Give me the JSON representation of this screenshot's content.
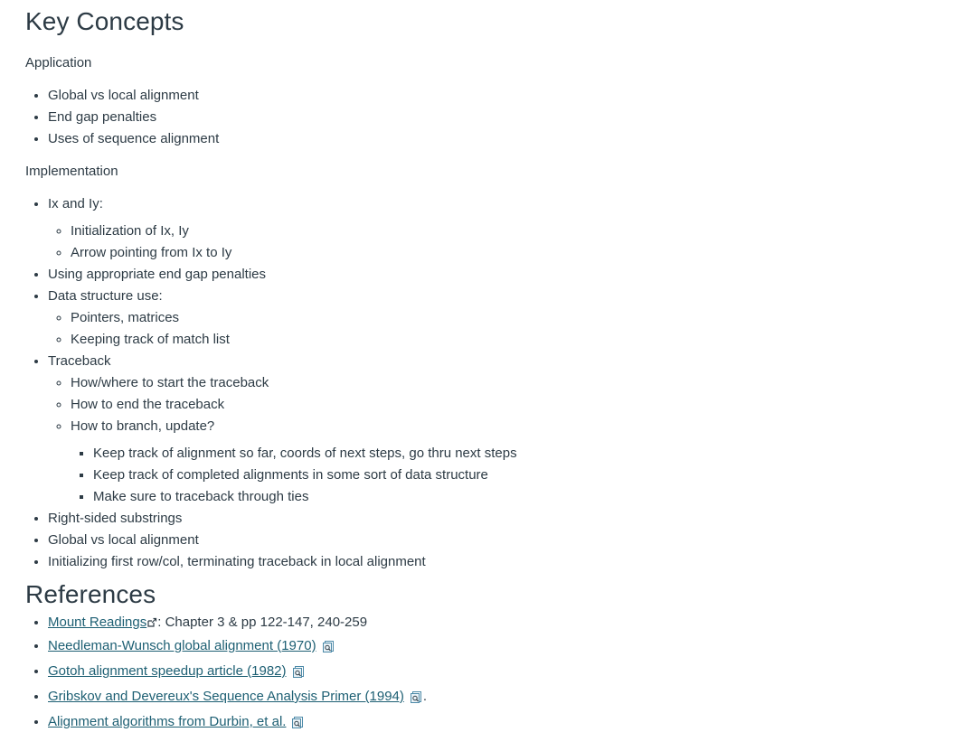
{
  "key_concepts": {
    "title": "Key Concepts",
    "application_label": "Application",
    "application_items": [
      "Global vs local alignment",
      "End gap penalties",
      "Uses of sequence alignment"
    ],
    "implementation_label": "Implementation",
    "ixiy": {
      "label": "Ix and Iy:",
      "children": [
        "Initialization of Ix, Iy",
        "Arrow pointing from Ix to Iy"
      ]
    },
    "end_gap": "Using appropriate end gap penalties",
    "data_structure": {
      "label": "Data structure use:",
      "children": [
        "Pointers, matrices",
        "Keeping track of match list"
      ]
    },
    "traceback": {
      "label": "Traceback",
      "children": [
        "How/where to start the traceback",
        "How to end the traceback",
        "How to branch, update?"
      ],
      "branch_children": [
        "Keep track of alignment so far, coords of next steps, go thru next steps",
        "Keep track of completed alignments in some sort of data structure",
        "Make sure to traceback through ties"
      ]
    },
    "right_sided": "Right-sided substrings",
    "global_vs_local": "Global vs local alignment",
    "initializing": "Initializing first row/col, terminating traceback in local alignment"
  },
  "references": {
    "title": "References",
    "items": [
      {
        "link": "Mount Readings",
        "suffix": ": Chapter 3 & pp 122-147, 240-259",
        "icon": "external-link-icon"
      },
      {
        "link": "Needleman-Wunsch global alignment (1970)",
        "suffix": "",
        "icon": "file-preview-icon"
      },
      {
        "link": "Gotoh alignment speedup article (1982)",
        "suffix": "",
        "icon": "file-preview-icon"
      },
      {
        "link": "Gribskov and Devereux's Sequence Analysis Primer (1994)",
        "suffix": ".",
        "icon": "file-preview-icon"
      },
      {
        "link": "Alignment algorithms from Durbin, et al.",
        "suffix": "",
        "icon": "file-preview-icon"
      }
    ]
  },
  "colors": {
    "text": "#2d3b45",
    "link": "#1d5f73"
  }
}
